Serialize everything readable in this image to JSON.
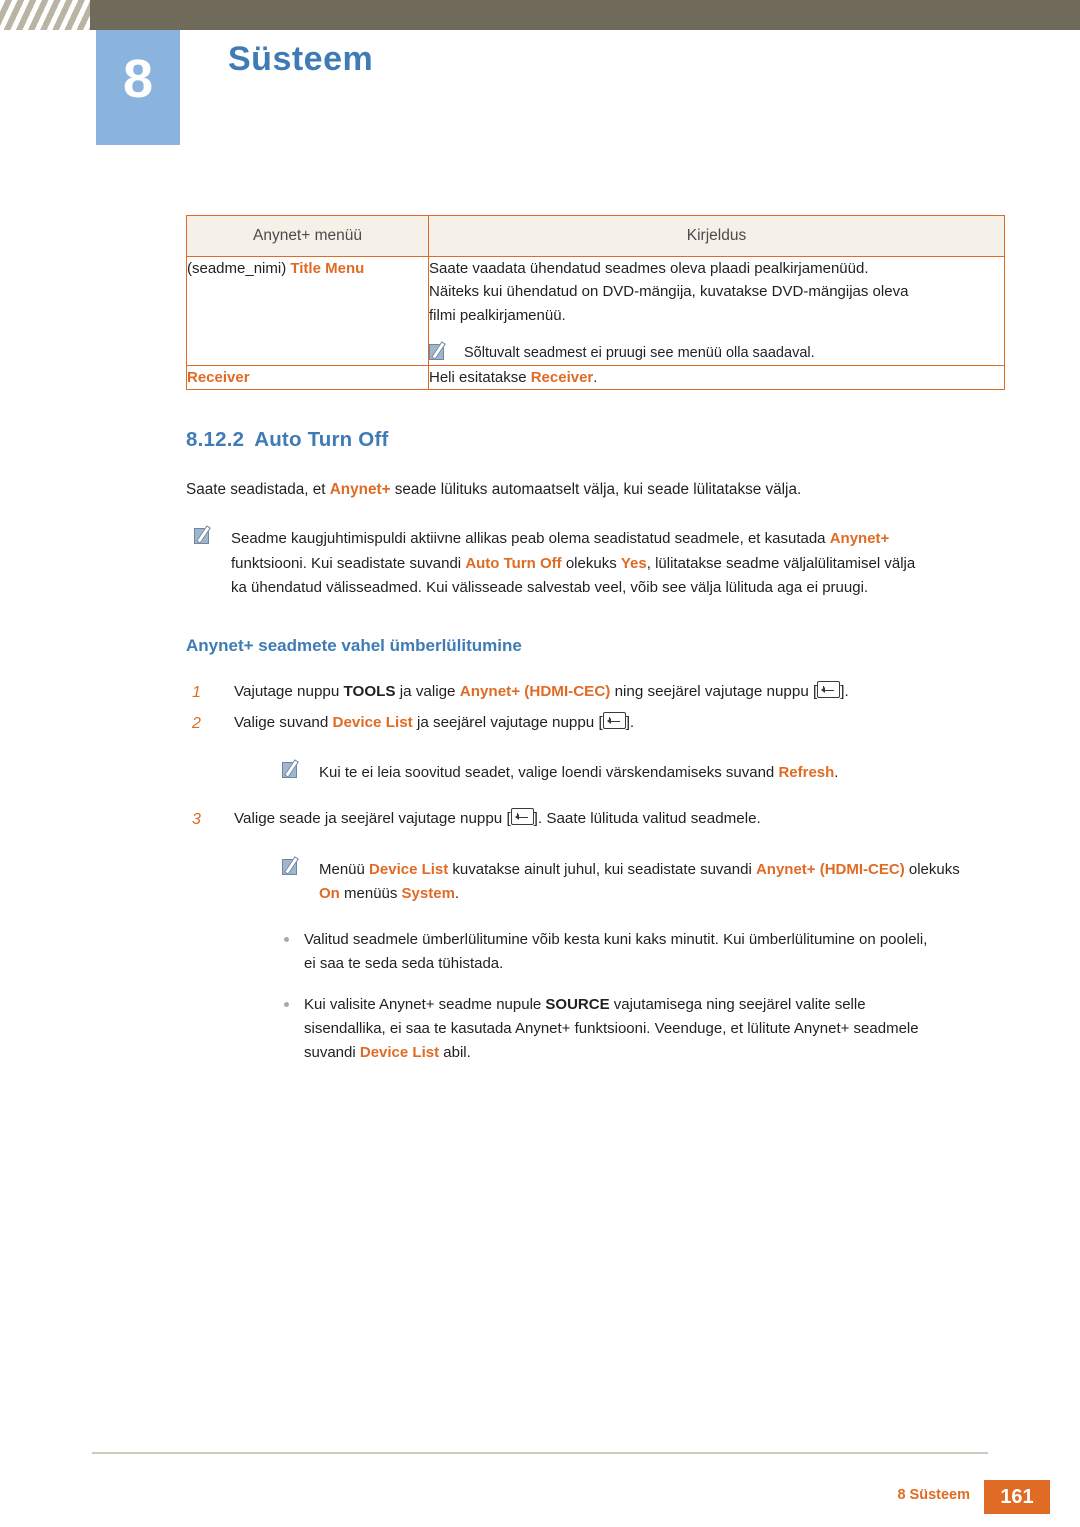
{
  "header": {
    "chapter_number": "8",
    "chapter_title": "Süsteem"
  },
  "table": {
    "headers": [
      "Anynet+ menüü",
      "Kirjeldus"
    ],
    "rows": [
      {
        "menu_prefix": "(seadme_nimi) ",
        "menu_highlight": "Title Menu",
        "desc_line1": "Saate vaadata ühendatud seadmes oleva plaadi pealkirjamenüüd.",
        "desc_line2": "Näiteks kui ühendatud on DVD-mängija, kuvatakse DVD-mängijas oleva",
        "desc_line3": "filmi pealkirjamenüü.",
        "note": "Sõltuvalt seadmest ei pruugi see menüü olla saadaval."
      },
      {
        "menu_highlight": "Receiver",
        "desc_pre": "Heli esitatakse ",
        "desc_highlight": "Receiver",
        "desc_post": "."
      }
    ]
  },
  "section": {
    "number": "8.12.2",
    "title": "Auto Turn Off",
    "intro_pre": "Saate seadistada, et ",
    "intro_hl": "Anynet+",
    "intro_post": " seade lülituks automaatselt välja, kui seade lülitatakse välja.",
    "note1": {
      "l1_a": "Seadme kaugjuhtimispuldi aktiivne allikas peab olema seadistatud seadmele, et kasutada ",
      "l1_hl": "Anynet+",
      "l2_a": "funktsiooni. Kui seadistate suvandi ",
      "l2_hl1": "Auto Turn Off",
      "l2_b": " olekuks ",
      "l2_hl2": "Yes",
      "l2_c": ", lülitatakse seadme väljalülitamisel välja",
      "l3": "ka ühendatud välisseadmed. Kui välisseade salvestab veel, võib see välja lülituda aga ei pruugi."
    }
  },
  "subsection": {
    "title": "Anynet+ seadmete vahel ümberlülitumine",
    "steps": [
      {
        "num": "1",
        "a": "Vajutage nuppu ",
        "hl1": "TOOLS",
        "b": " ja valige ",
        "hl2": "Anynet+ (HDMI-CEC)",
        "c": " ning seejärel vajutage nuppu [",
        "d": "]."
      },
      {
        "num": "2",
        "a": "Valige suvand ",
        "hl1": "Device List",
        "b": " ja seejärel vajutage nuppu [",
        "d": "]."
      },
      {
        "num": "3",
        "a": "Valige seade ja seejärel vajutage nuppu [",
        "d": "]. Saate lülituda valitud seadmele."
      }
    ],
    "note_refresh": {
      "a": "Kui te ei leia soovitud seadet, valige loendi värskendamiseks suvand ",
      "hl": "Refresh",
      "b": "."
    },
    "note_devicelist": {
      "a": "Menüü ",
      "hl1": "Device List",
      "b": " kuvatakse ainult juhul, kui seadistate suvandi ",
      "hl2": "Anynet+ (HDMI-CEC)",
      "c": " olekuks",
      "d_hl": "On",
      "d": " menüüs ",
      "e_hl": "System",
      "f": "."
    },
    "bullets": [
      {
        "l1": "Valitud seadmele ümberlülitumine võib kesta kuni kaks minutit. Kui ümberlülitumine on pooleli,",
        "l2": "ei saa te seda seda tühistada."
      },
      {
        "a": "Kui valisite Anynet+ seadme nupule ",
        "hl1": "SOURCE",
        "b": " vajutamisega ning seejärel valite selle",
        "l2": "sisendallika, ei saa te kasutada Anynet+ funktsiooni. Veenduge, et lülitute Anynet+ seadmele",
        "l3_a": "suvandi ",
        "l3_hl": "Device List",
        "l3_b": " abil."
      }
    ]
  },
  "footer": {
    "label": "8 Süsteem",
    "page": "161"
  },
  "colors": {
    "accent_orange": "#e06b24",
    "accent_blue": "#3f7bb5",
    "header_bar": "#6f6a5a",
    "badge_blue": "#8ab4dd"
  }
}
